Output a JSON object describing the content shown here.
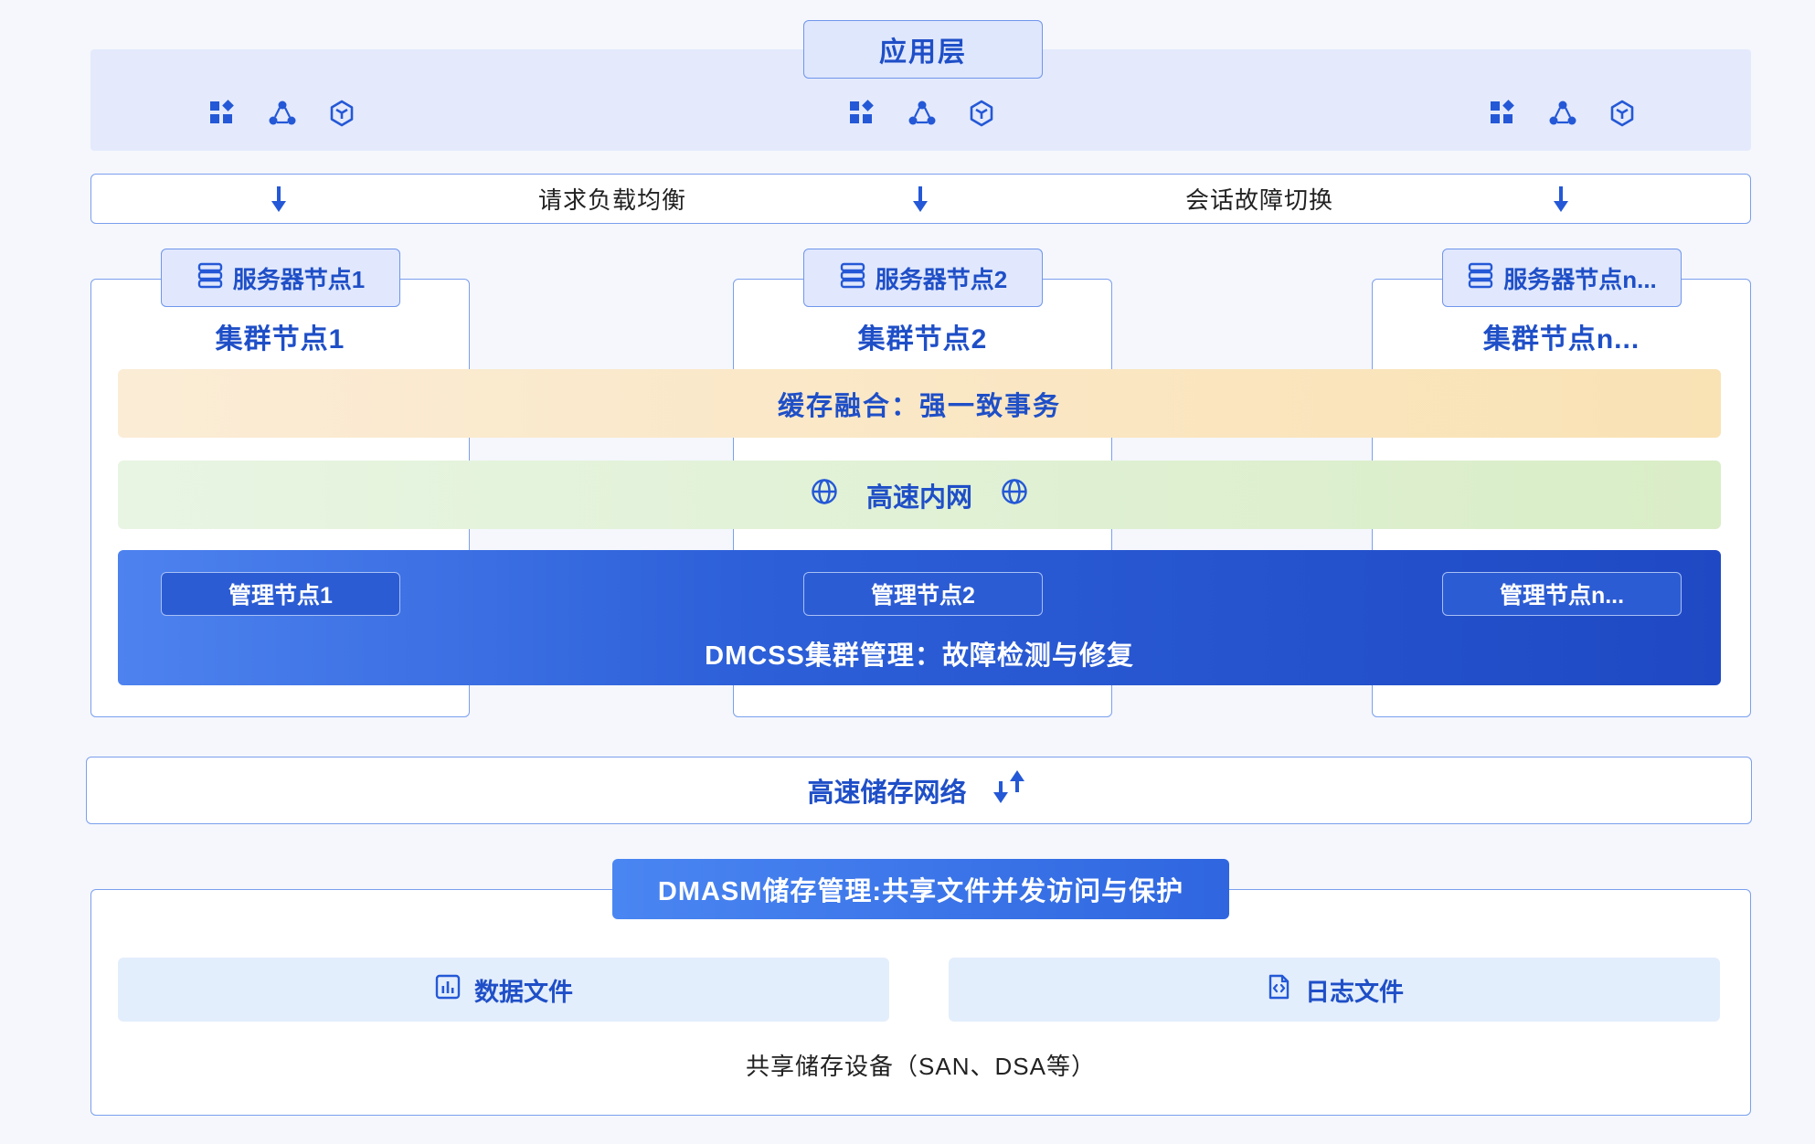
{
  "app_layer": {
    "title": "应用层",
    "icon_groups": [
      [
        "apps-icon",
        "nodes-icon",
        "cube-icon"
      ],
      [
        "apps-icon",
        "nodes-icon",
        "cube-icon"
      ],
      [
        "apps-icon",
        "nodes-icon",
        "cube-icon"
      ]
    ]
  },
  "load_balance": {
    "left_label": "请求负载均衡",
    "right_label": "会话故障切换"
  },
  "clusters": [
    {
      "server": "服务器节点1",
      "cluster": "集群节点1",
      "mgmt": "管理节点1"
    },
    {
      "server": "服务器节点2",
      "cluster": "集群节点2",
      "mgmt": "管理节点2"
    },
    {
      "server": "服务器节点n...",
      "cluster": "集群节点n...",
      "mgmt": "管理节点n..."
    }
  ],
  "cache_layer": "缓存融合：强一致事务",
  "network_layer": "高速内网",
  "dmcss": "DMCSS集群管理：故障检测与修复",
  "storage_network": "高速储存网络",
  "dmasm": {
    "title": "DMASM储存管理:共享文件并发访问与保护",
    "data_file": "数据文件",
    "log_file": "日志文件",
    "shared_device": "共享储存设备（SAN、DSA等）"
  },
  "colors": {
    "primary": "#1f4fc7",
    "border": "#7b9fee",
    "cache": "#f9e2b4",
    "network": "#d9edc7",
    "dmcss": "#2c5fd8"
  }
}
